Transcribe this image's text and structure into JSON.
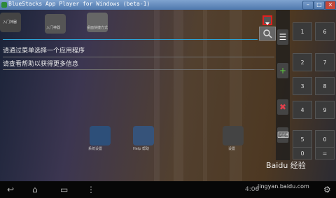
{
  "window": {
    "title": "BlueStacks App Player for Windows (beta-1)"
  },
  "home": {
    "shortcuts": [
      {
        "label": "入门神器"
      },
      {
        "label": "入门神器"
      },
      {
        "label": "桌面快捷方式"
      }
    ],
    "dock_icons": [
      {
        "label": "系统设置"
      },
      {
        "label": "Help 帮助"
      },
      {
        "label": "设置"
      }
    ]
  },
  "search": {
    "value": "",
    "hint_1": "请通过菜单选择一个应用程序",
    "hint_2": "请查看帮助以获得更多信息"
  },
  "keypad": {
    "keys": [
      "1",
      "2",
      "3",
      "4",
      "5",
      "0"
    ],
    "right_keys": [
      "6",
      "7",
      "8",
      "9",
      "0",
      "="
    ]
  },
  "status": {
    "time": "4:06"
  },
  "watermark": {
    "brand": "Baidu 经验",
    "url": "jingyan.baidu.com"
  },
  "colors": {
    "accent": "#2ca3d6",
    "highlight": "#e02020"
  }
}
